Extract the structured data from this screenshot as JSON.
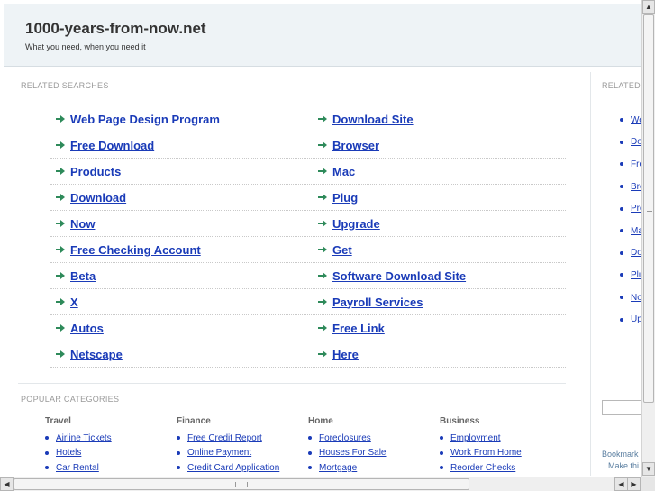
{
  "header": {
    "site_title": "1000-years-from-now.net",
    "tagline": "What you need, when you need it"
  },
  "related_searches": {
    "heading": "RELATED SEARCHES",
    "left": [
      {
        "label": "Web Page Design Program",
        "underlined": false
      },
      {
        "label": "Free Download",
        "underlined": true
      },
      {
        "label": "Products",
        "underlined": true
      },
      {
        "label": "Download",
        "underlined": true
      },
      {
        "label": "Now",
        "underlined": true
      },
      {
        "label": "Free Checking Account",
        "underlined": true
      },
      {
        "label": "Beta",
        "underlined": true
      },
      {
        "label": "X",
        "underlined": true
      },
      {
        "label": "Autos",
        "underlined": true
      },
      {
        "label": "Netscape",
        "underlined": true
      }
    ],
    "right": [
      {
        "label": "Download Site",
        "underlined": true
      },
      {
        "label": "Browser",
        "underlined": true
      },
      {
        "label": "Mac",
        "underlined": true
      },
      {
        "label": "Plug",
        "underlined": true
      },
      {
        "label": "Upgrade",
        "underlined": true
      },
      {
        "label": "Get",
        "underlined": true
      },
      {
        "label": "Software Download Site",
        "underlined": true
      },
      {
        "label": "Payroll Services",
        "underlined": true
      },
      {
        "label": "Free Link",
        "underlined": true
      },
      {
        "label": "Here",
        "underlined": true
      }
    ]
  },
  "popular_categories": {
    "heading": "POPULAR CATEGORIES",
    "columns": [
      {
        "title": "Travel",
        "items": [
          "Airline Tickets",
          "Hotels",
          "Car Rental"
        ]
      },
      {
        "title": "Finance",
        "items": [
          "Free Credit Report",
          "Online Payment",
          "Credit Card Application"
        ]
      },
      {
        "title": "Home",
        "items": [
          "Foreclosures",
          "Houses For Sale",
          "Mortgage"
        ]
      },
      {
        "title": "Business",
        "items": [
          "Employment",
          "Work From Home",
          "Reorder Checks"
        ]
      }
    ]
  },
  "sidebar": {
    "heading": "RELATED",
    "items": [
      "We",
      "Do",
      "Fre",
      "Bro",
      "Pro",
      "Ma",
      "Do",
      "Plu",
      "No",
      "Up"
    ],
    "bookmark_text": "Bookmark",
    "make_text": "Make thi"
  },
  "scrollbars": {
    "up_arrow": "▲",
    "down_arrow": "▼",
    "left_arrow": "◀",
    "right_arrow": "▶"
  },
  "colors": {
    "link": "#1a3bb8",
    "arrow": "#2e8a5a",
    "header_bg": "#eef3f6"
  }
}
